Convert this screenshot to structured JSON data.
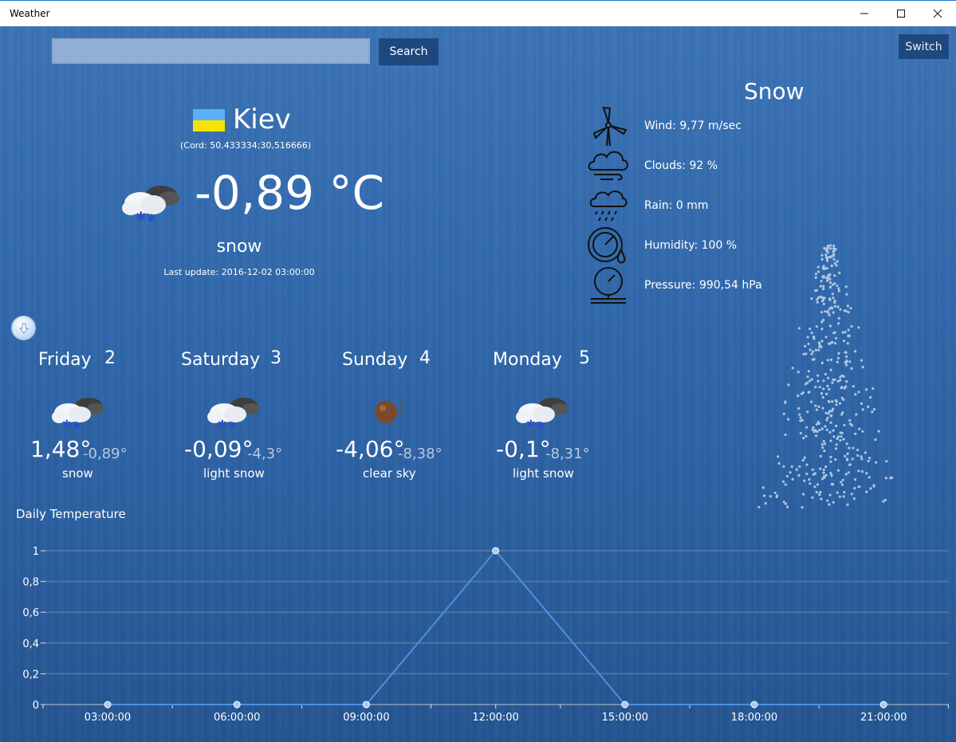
{
  "window": {
    "title": "Weather"
  },
  "toolbar": {
    "search_placeholder": "",
    "search_label": "Search",
    "switch_label": "Switch"
  },
  "current": {
    "city": "Kiev",
    "coords": "(Cord: 50,433334;30,516666)",
    "temperature": "-0,89 °C",
    "description": "snow",
    "last_update": "Last update: 2016-12-02 03:00:00",
    "icon": "snow-cloud-icon",
    "flag_colors": [
      "#5ab1f5",
      "#f5e400"
    ]
  },
  "details": {
    "condition": "Snow",
    "wind": "Wind: 9,77 m/sec",
    "clouds": "Clouds: 92 %",
    "rain": "Rain: 0 mm",
    "humidity": "Humidity: 100 %",
    "pressure": "Pressure: 990,54 hPa"
  },
  "forecast": [
    {
      "day": "Friday",
      "date": "2",
      "high": "1,48°",
      "low": "-0,89°",
      "description": "snow",
      "icon": "snow-cloud-icon"
    },
    {
      "day": "Saturday",
      "date": "3",
      "high": "-0,09°",
      "low": "-4,3°",
      "description": "light snow",
      "icon": "snow-cloud-icon"
    },
    {
      "day": "Sunday",
      "date": "4",
      "high": "-4,06°",
      "low": "-8,38°",
      "description": "clear sky",
      "icon": "moon-icon"
    },
    {
      "day": "Monday",
      "date": "5",
      "high": "-0,1°",
      "low": "-8,31°",
      "description": "light snow",
      "icon": "snow-cloud-icon"
    }
  ],
  "chart_title": "Daily Temperature",
  "chart_data": {
    "type": "line",
    "title": "Daily Temperature",
    "x": [
      "03:00:00",
      "06:00:00",
      "09:00:00",
      "12:00:00",
      "15:00:00",
      "18:00:00",
      "21:00:00"
    ],
    "series": [
      {
        "values": [
          0,
          0,
          0,
          1,
          0,
          0,
          0
        ]
      }
    ],
    "ylim": [
      0,
      1
    ],
    "yticks": [
      "0",
      "0,2",
      "0,4",
      "0,6",
      "0,8",
      "1"
    ],
    "grid": true,
    "line_color": "#4d8fe0"
  }
}
